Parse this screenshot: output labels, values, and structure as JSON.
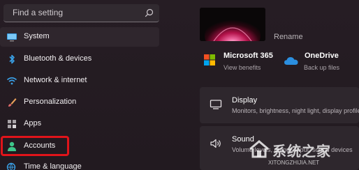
{
  "search": {
    "placeholder": "Find a setting"
  },
  "sidebar": {
    "items": [
      {
        "label": "System",
        "icon": "monitor-icon"
      },
      {
        "label": "Bluetooth & devices",
        "icon": "bluetooth-icon"
      },
      {
        "label": "Network & internet",
        "icon": "wifi-icon"
      },
      {
        "label": "Personalization",
        "icon": "brush-icon"
      },
      {
        "label": "Apps",
        "icon": "apps-icon"
      },
      {
        "label": "Accounts",
        "icon": "person-icon"
      },
      {
        "label": "Time & language",
        "icon": "globe-clock-icon"
      }
    ],
    "selected_index": 0,
    "highlighted_index": 5
  },
  "device": {
    "rename_label": "Rename"
  },
  "services": [
    {
      "title": "Microsoft 365",
      "subtitle": "View benefits",
      "icon": "microsoft-logo-icon"
    },
    {
      "title": "OneDrive",
      "subtitle": "Back up files",
      "icon": "onedrive-cloud-icon"
    }
  ],
  "cards": [
    {
      "title": "Display",
      "subtitle": "Monitors, brightness, night light, display profile",
      "icon": "display-icon"
    },
    {
      "title": "Sound",
      "subtitle": "Volume levels, output, input, sound devices",
      "icon": "speaker-icon"
    }
  ],
  "watermark": {
    "text": "系统之家",
    "url": "XITONGZHIJIA.NET"
  },
  "colors": {
    "background": "#241c22",
    "highlight": "#e0141a",
    "accent": "#60cdff"
  }
}
